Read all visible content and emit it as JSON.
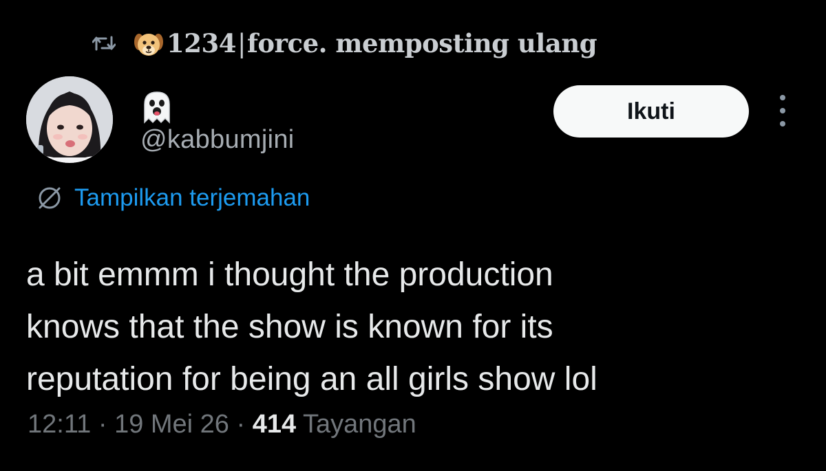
{
  "repost": {
    "emoji_icon": "dog-face-emoji",
    "text": "1234",
    "separator": "|",
    "suffix": "force. memposting ulang"
  },
  "author": {
    "display_name_emoji": "ghost-emoji",
    "handle": "@kabbumjini",
    "avatar": "profile-photo"
  },
  "follow_button": {
    "label": "Ikuti"
  },
  "translate": {
    "label": "Tampilkan terjemahan"
  },
  "tweet": {
    "lines": [
      "a bit emmm i thought the production",
      "knows that the show is known for its",
      "reputation for being an all girls show lol"
    ]
  },
  "meta": {
    "time": "12:11",
    "date": "19 Mei 26",
    "dot": "·",
    "views_count": "414",
    "views_label": "Tayangan"
  },
  "colors": {
    "background": "#000000",
    "text_primary": "#e7e9ea",
    "text_secondary": "#71767b",
    "link": "#1d9bf0",
    "button_bg": "#f7f9f9"
  }
}
